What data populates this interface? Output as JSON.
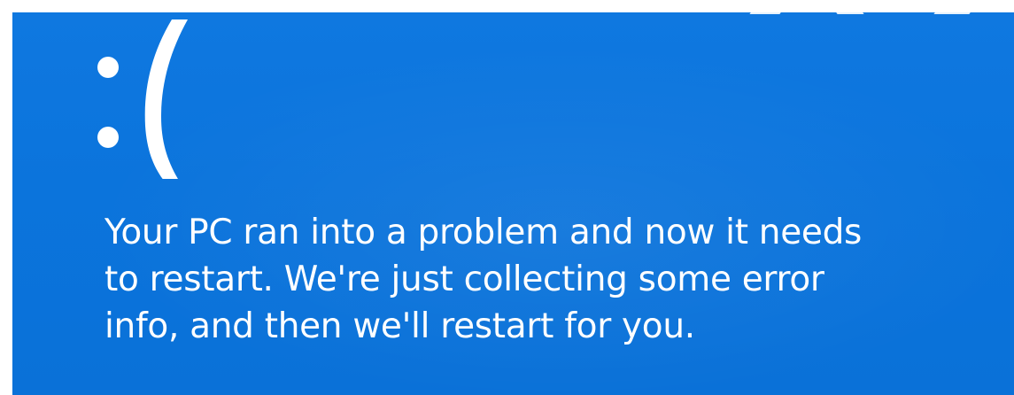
{
  "screen": {
    "background_color": "#0b74dc",
    "text_color": "#ffffff",
    "frown": ":(",
    "message_lines": [
      "Your PC ran into a problem and now it needs",
      "to restart. We're just collecting some error",
      "info, and then we'll restart for you."
    ]
  }
}
